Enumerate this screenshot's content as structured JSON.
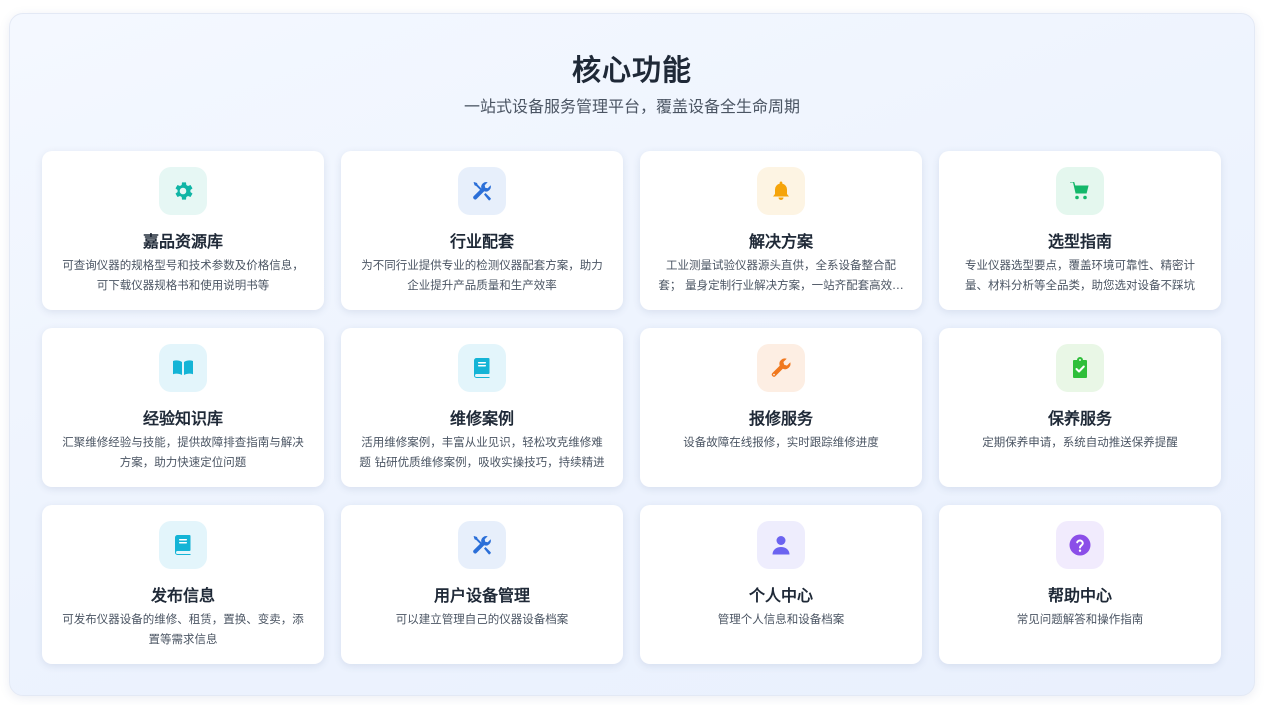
{
  "header": {
    "title": "核心功能",
    "subtitle": "一站式设备服务管理平台，覆盖设备全生命周期"
  },
  "colors": {
    "teal": "#0fb5a5",
    "blue": "#2b6fd8",
    "amber": "#f5a40a",
    "green": "#14b86a",
    "cyan": "#14b4d6",
    "orange": "#f0781e",
    "lime": "#2fbf3a",
    "indigo": "#6b63f0",
    "purple": "#8b4ee8"
  },
  "cards": [
    {
      "title": "嘉品资源库",
      "desc": "可查询仪器的规格型号和技术参数及价格信息，可下载仪器规格书和使用说明书等",
      "icon": "gear-icon"
    },
    {
      "title": "行业配套",
      "desc": "为不同行业提供专业的检测仪器配套方案，助力企业提升产品质量和生产效率",
      "icon": "tools-icon"
    },
    {
      "title": "解决方案",
      "desc": "工业测量试验仪器源头直供，全系设备整合配套；  量身定制行业解决方案，一站齐配套高效省心",
      "icon": "bell-icon"
    },
    {
      "title": "选型指南",
      "desc": "专业仪器选型要点，覆盖环境可靠性、精密计量、材料分析等全品类，助您选对设备不踩坑",
      "icon": "cart-icon"
    },
    {
      "title": "经验知识库",
      "desc": "汇聚维修经验与技能，提供故障排查指南与解决方案，助力快速定位问题",
      "icon": "book-open-icon"
    },
    {
      "title": "维修案例",
      "desc": "活用维修案例，丰富从业见识，轻松攻克维修难题 钻研优质维修案例，吸收实操技巧，持续精进",
      "icon": "book-icon"
    },
    {
      "title": "报修服务",
      "desc": "设备故障在线报修，实时跟踪维修进度",
      "icon": "wrench-icon"
    },
    {
      "title": "保养服务",
      "desc": "定期保养申请，系统自动推送保养提醒",
      "icon": "clipboard-check-icon"
    },
    {
      "title": "发布信息",
      "desc": "可发布仪器设备的维修、租赁，置换、变卖，添置等需求信息",
      "icon": "book-icon"
    },
    {
      "title": "用户设备管理",
      "desc": "可以建立管理自己的仪器设备档案",
      "icon": "tools-icon"
    },
    {
      "title": "个人中心",
      "desc": "管理个人信息和设备档案",
      "icon": "user-icon"
    },
    {
      "title": "帮助中心",
      "desc": "常见问题解答和操作指南",
      "icon": "question-icon"
    }
  ]
}
